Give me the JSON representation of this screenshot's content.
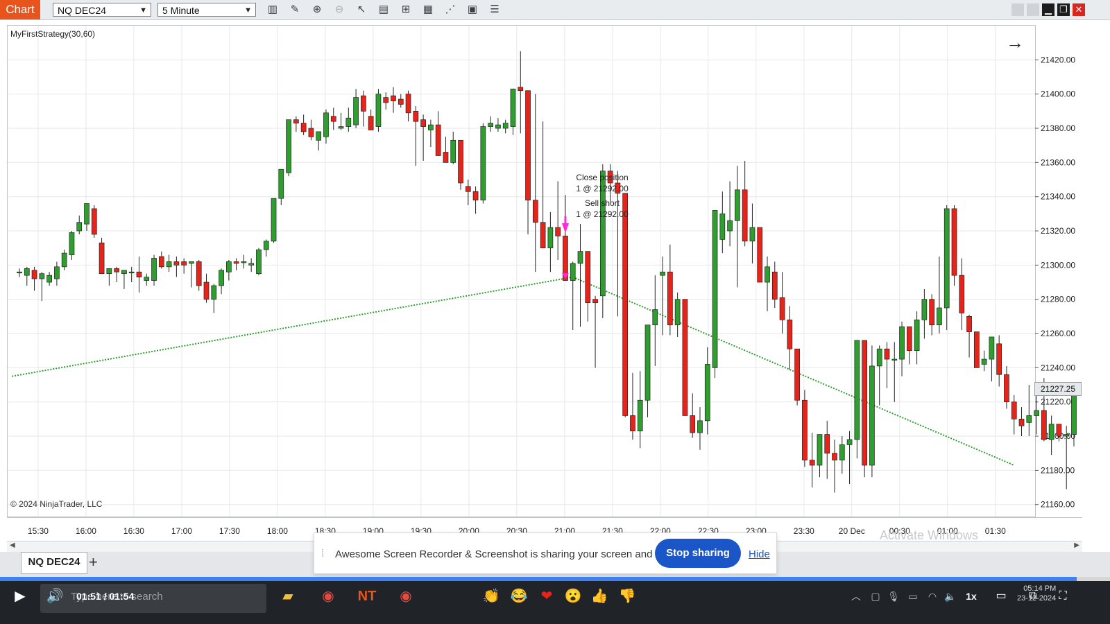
{
  "toolbar": {
    "chart_label": "Chart",
    "instrument": "NQ DEC24",
    "interval": "5 Minute"
  },
  "chart": {
    "strategy_label": "MyFirstStrategy(30,60)",
    "copyright": "© 2024 NinjaTrader, LLC",
    "current_price": "21227.25",
    "annotations": {
      "close_title": "Close position",
      "close_detail": "1 @ 21292.00",
      "sell_title": "Sell short",
      "sell_detail": "1 @ 21292.00"
    }
  },
  "chart_data": {
    "type": "candlestick",
    "instrument": "NQ DEC24",
    "interval": "5 Minute",
    "y_ticks": [
      "21420.00",
      "21400.00",
      "21380.00",
      "21360.00",
      "21340.00",
      "21320.00",
      "21300.00",
      "21280.00",
      "21260.00",
      "21240.00",
      "21220.00",
      "21200.00",
      "21180.00",
      "21160.00"
    ],
    "x_ticks": [
      "15:30",
      "16:00",
      "16:30",
      "17:00",
      "17:30",
      "18:00",
      "18:30",
      "19:00",
      "19:30",
      "20:00",
      "20:30",
      "21:00",
      "21:30",
      "22:00",
      "22:30",
      "23:00",
      "23:30",
      "20 Dec",
      "00:30",
      "01:00",
      "01:30"
    ],
    "ylim": [
      21153,
      21440
    ],
    "up_color": "#2e9e2e",
    "down_color": "#e8231a",
    "candles": [
      [
        21296,
        21298,
        21293,
        21296
      ],
      [
        21294,
        21299,
        21288,
        21298
      ],
      [
        21297,
        21299,
        21285,
        21292
      ],
      [
        21292,
        21296,
        21279,
        21295
      ],
      [
        21290,
        21296,
        21288,
        21294
      ],
      [
        21292,
        21302,
        21288,
        21299
      ],
      [
        21299,
        21309,
        21297,
        21307
      ],
      [
        21306,
        21320,
        21303,
        21319
      ],
      [
        21320,
        21329,
        21318,
        21325
      ],
      [
        21324,
        21336,
        21320,
        21336
      ],
      [
        21333,
        21335,
        21316,
        21318
      ],
      [
        21313,
        21316,
        21295,
        21295
      ],
      [
        21295,
        21297,
        21288,
        21298
      ],
      [
        21298,
        21299,
        21290,
        21296
      ],
      [
        21295,
        21297,
        21286,
        21297
      ],
      [
        21296,
        21299,
        21290,
        21296
      ],
      [
        21296,
        21305,
        21284,
        21293
      ],
      [
        21291,
        21295,
        21288,
        21293
      ],
      [
        21291,
        21306,
        21288,
        21304
      ],
      [
        21305,
        21308,
        21298,
        21299
      ],
      [
        21299,
        21306,
        21296,
        21302
      ],
      [
        21302,
        21305,
        21293,
        21300
      ],
      [
        21302,
        21304,
        21295,
        21300
      ],
      [
        21301,
        21302,
        21287,
        21302
      ],
      [
        21302,
        21303,
        21285,
        21288
      ],
      [
        21290,
        21295,
        21278,
        21280
      ],
      [
        21280,
        21289,
        21272,
        21288
      ],
      [
        21288,
        21298,
        21283,
        21297
      ],
      [
        21296,
        21303,
        21291,
        21302
      ],
      [
        21302,
        21304,
        21297,
        21301
      ],
      [
        21302,
        21306,
        21298,
        21302
      ],
      [
        21300,
        21304,
        21296,
        21301
      ],
      [
        21295,
        21310,
        21294,
        21309
      ],
      [
        21309,
        21315,
        21305,
        21314
      ],
      [
        21314,
        21325,
        21313,
        21339
      ],
      [
        21339,
        21354,
        21335,
        21356
      ],
      [
        21354,
        21385,
        21352,
        21385
      ],
      [
        21385,
        21387,
        21378,
        21383
      ],
      [
        21383,
        21388,
        21376,
        21378
      ],
      [
        21380,
        21385,
        21373,
        21375
      ],
      [
        21373,
        21378,
        21367,
        21378
      ],
      [
        21375,
        21391,
        21371,
        21389
      ],
      [
        21387,
        21392,
        21379,
        21384
      ],
      [
        21380,
        21389,
        21379,
        21381
      ],
      [
        21381,
        21392,
        21378,
        21386
      ],
      [
        21382,
        21403,
        21380,
        21398
      ],
      [
        21399,
        21402,
        21381,
        21390
      ],
      [
        21387,
        21391,
        21381,
        21379
      ],
      [
        21381,
        21403,
        21378,
        21400
      ],
      [
        21398,
        21401,
        21391,
        21395
      ],
      [
        21399,
        21404,
        21389,
        21396
      ],
      [
        21397,
        21400,
        21392,
        21394
      ],
      [
        21400,
        21402,
        21384,
        21389
      ],
      [
        21390,
        21393,
        21358,
        21384
      ],
      [
        21385,
        21388,
        21361,
        21381
      ],
      [
        21379,
        21385,
        21369,
        21382
      ],
      [
        21382,
        21390,
        21367,
        21364
      ],
      [
        21366,
        21375,
        21363,
        21360
      ],
      [
        21360,
        21378,
        21359,
        21373
      ],
      [
        21373,
        21361,
        21344,
        21348
      ],
      [
        21346,
        21350,
        21335,
        21343
      ],
      [
        21343,
        21346,
        21330,
        21338
      ],
      [
        21338,
        21383,
        21336,
        21381
      ],
      [
        21381,
        21387,
        21378,
        21383
      ],
      [
        21380,
        21386,
        21378,
        21382
      ],
      [
        21380,
        21385,
        21377,
        21383
      ],
      [
        21381,
        21400,
        21376,
        21403
      ],
      [
        21404,
        21425,
        21377,
        21402
      ],
      [
        21402,
        21402,
        21318,
        21338
      ],
      [
        21338,
        21400,
        21296,
        21325
      ],
      [
        21325,
        21384,
        21315,
        21310
      ],
      [
        21310,
        21331,
        21296,
        21322
      ],
      [
        21322,
        21349,
        21303,
        21317
      ],
      [
        21317,
        21341,
        21303,
        21291
      ],
      [
        21291,
        21302,
        21262,
        21301
      ],
      [
        21301,
        21324,
        21264,
        21308
      ],
      [
        21308,
        21304,
        21267,
        21278
      ],
      [
        21280,
        21282,
        21240,
        21278
      ],
      [
        21282,
        21359,
        21269,
        21355
      ],
      [
        21355,
        21359,
        21337,
        21348
      ],
      [
        21348,
        21355,
        21270,
        21342
      ],
      [
        21342,
        21267,
        21211,
        21212
      ],
      [
        21212,
        21237,
        21198,
        21203
      ],
      [
        21203,
        21238,
        21193,
        21221
      ],
      [
        21221,
        21263,
        21211,
        21265
      ],
      [
        21265,
        21294,
        21241,
        21274
      ],
      [
        21294,
        21305,
        21259,
        21296
      ],
      [
        21296,
        21312,
        21259,
        21265
      ],
      [
        21265,
        21284,
        21258,
        21280
      ],
      [
        21280,
        21279,
        21219,
        21212
      ],
      [
        21212,
        21225,
        21199,
        21202
      ],
      [
        21202,
        21217,
        21192,
        21209
      ],
      [
        21209,
        21252,
        21201,
        21242
      ],
      [
        21240,
        21332,
        21234,
        21332
      ],
      [
        21315,
        21343,
        21307,
        21330
      ],
      [
        21320,
        21349,
        21311,
        21326
      ],
      [
        21326,
        21358,
        21287,
        21344
      ],
      [
        21344,
        21361,
        21311,
        21314
      ],
      [
        21314,
        21336,
        21301,
        21322
      ],
      [
        21322,
        21319,
        21296,
        21290
      ],
      [
        21290,
        21305,
        21273,
        21299
      ],
      [
        21296,
        21302,
        21275,
        21280
      ],
      [
        21281,
        21296,
        21260,
        21268
      ],
      [
        21268,
        21276,
        21239,
        21251
      ],
      [
        21251,
        21240,
        21218,
        21221
      ],
      [
        21221,
        21227,
        21182,
        21186
      ],
      [
        21186,
        21202,
        21170,
        21183
      ],
      [
        21183,
        21195,
        21176,
        21201
      ],
      [
        21201,
        21209,
        21175,
        21190
      ],
      [
        21190,
        21198,
        21167,
        21186
      ],
      [
        21186,
        21200,
        21178,
        21195
      ],
      [
        21195,
        21203,
        21172,
        21198
      ],
      [
        21198,
        21256,
        21187,
        21256
      ],
      [
        21256,
        21252,
        21176,
        21183
      ],
      [
        21183,
        21253,
        21176,
        21241
      ],
      [
        21241,
        21253,
        21218,
        21251
      ],
      [
        21251,
        21255,
        21228,
        21245
      ],
      [
        21245,
        21255,
        21220,
        21245
      ],
      [
        21245,
        21267,
        21235,
        21264
      ],
      [
        21264,
        21262,
        21242,
        21250
      ],
      [
        21250,
        21273,
        21242,
        21268
      ],
      [
        21268,
        21286,
        21257,
        21280
      ],
      [
        21280,
        21283,
        21259,
        21265
      ],
      [
        21265,
        21305,
        21260,
        21275
      ],
      [
        21275,
        21335,
        21262,
        21333
      ],
      [
        21333,
        21335,
        21288,
        21294
      ],
      [
        21294,
        21304,
        21262,
        21272
      ],
      [
        21270,
        21271,
        21246,
        21261
      ],
      [
        21261,
        21259,
        21244,
        21240
      ],
      [
        21242,
        21250,
        21238,
        21245
      ],
      [
        21245,
        21258,
        21232,
        21258
      ],
      [
        21254,
        21259,
        21229,
        21236
      ],
      [
        21236,
        21241,
        21216,
        21220
      ],
      [
        21220,
        21224,
        21201,
        21210
      ],
      [
        21210,
        21217,
        21200,
        21206
      ],
      [
        21208,
        21230,
        21200,
        21212
      ],
      [
        21212,
        21228,
        21201,
        21215
      ],
      [
        21215,
        21234,
        21197,
        21198
      ],
      [
        21198,
        21212,
        21189,
        21207
      ],
      [
        21207,
        21207,
        21197,
        21200
      ],
      [
        21200,
        21206,
        21169,
        21201
      ],
      [
        21201,
        21230,
        21194,
        21227
      ]
    ],
    "trend_lines": [
      {
        "from_bar": -1,
        "from_price": 21235,
        "to_bar": 74,
        "to_price": 21293,
        "color": "#2e9e2e",
        "style": "dotted"
      },
      {
        "from_bar": 74,
        "from_price": 21293,
        "to_bar": 133,
        "to_price": 21183,
        "color": "#2e9e2e",
        "style": "dotted"
      }
    ],
    "markers": [
      {
        "bar": 73,
        "type": "sell-short-arrow",
        "color": "#ff2bd6",
        "price": 21292
      }
    ]
  },
  "tabs": {
    "active": "NQ DEC24",
    "add": "+"
  },
  "share_bar": {
    "message": "Awesome Screen Recorder & Screenshot is sharing your screen and audio.",
    "stop": "Stop sharing",
    "hide": "Hide"
  },
  "watermark": {
    "activate": "Activate Windows"
  },
  "player": {
    "timecode": "01:51 / 01:54",
    "progress": 0.97
  },
  "taskbar": {
    "search_placeholder": "Type here to search",
    "speed": "1x",
    "time": "05:14 PM",
    "date": "23-12-2024",
    "reactions": [
      "👏",
      "😂",
      "❤",
      "😮",
      "👍",
      "👎"
    ]
  }
}
